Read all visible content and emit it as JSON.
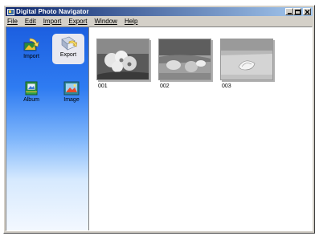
{
  "window": {
    "title": "Digital Photo Navigator"
  },
  "menu": {
    "items": [
      "File",
      "Edit",
      "Import",
      "Export",
      "Window",
      "Help"
    ]
  },
  "sidebar": {
    "buttons": [
      {
        "label": "Import",
        "icon": "import-icon",
        "selected": false
      },
      {
        "label": "Export",
        "icon": "export-icon",
        "selected": true
      },
      {
        "label": "Album",
        "icon": "album-icon",
        "selected": false
      },
      {
        "label": "Image",
        "icon": "image-icon",
        "selected": false
      }
    ]
  },
  "thumbnails": [
    {
      "label": "001",
      "subject": "flowers"
    },
    {
      "label": "002",
      "subject": "shells"
    },
    {
      "label": "003",
      "subject": "seashell"
    }
  ],
  "colors": {
    "titlebar_start": "#0a246a",
    "titlebar_end": "#a6caf0",
    "sidebar_top": "#1c5fe0",
    "sidebar_bottom": "#f3f8ff",
    "window_face": "#d4d0c8"
  }
}
